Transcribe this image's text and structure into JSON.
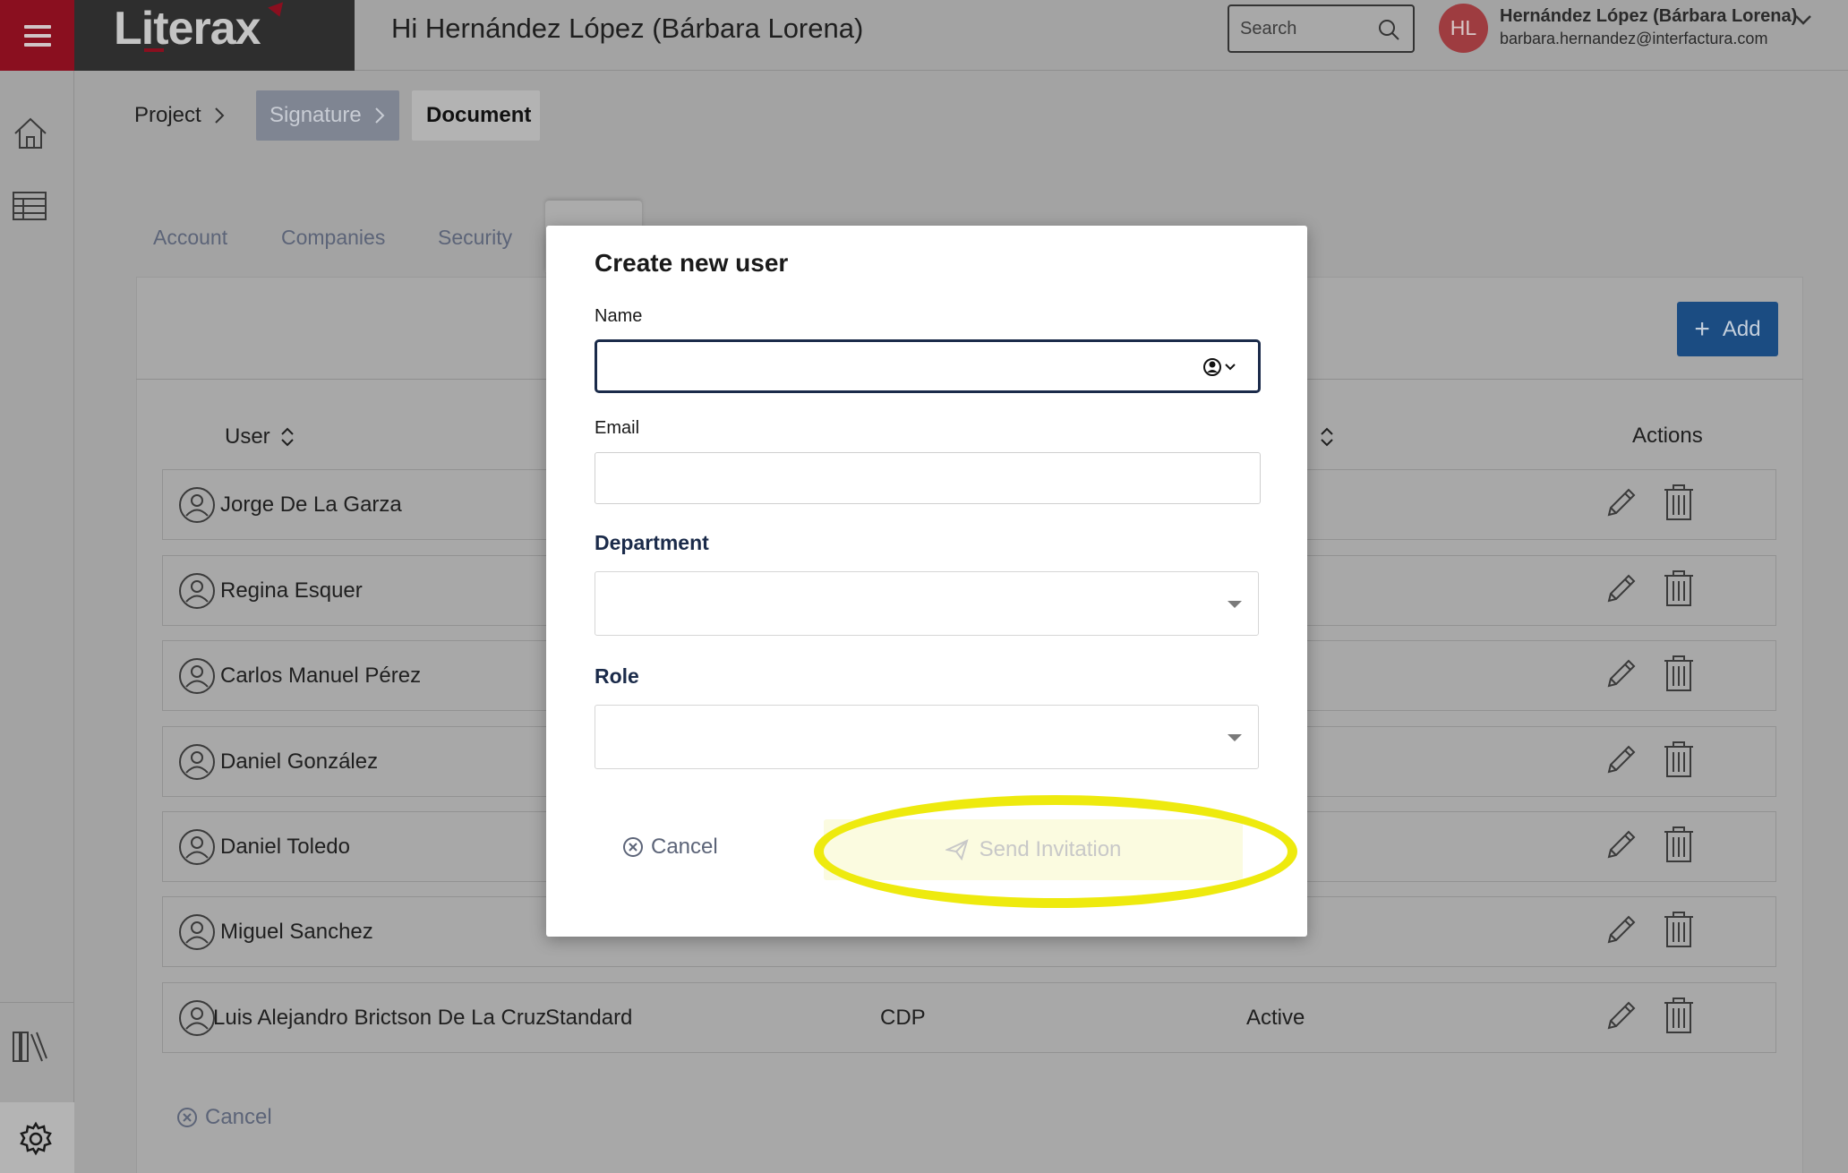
{
  "app": {
    "logo": "Literax",
    "greeting": "Hi Hernández López (Bárbara Lorena)"
  },
  "search": {
    "placeholder": "Search"
  },
  "user": {
    "initials": "HL",
    "name": "Hernández López (Bárbara Lorena)",
    "email": "barbara.hernandez@interfactura.com"
  },
  "breadcrumb": {
    "project": "Project",
    "signature": "Signature",
    "document": "Document"
  },
  "tabs": [
    "Account",
    "Companies",
    "Security"
  ],
  "table": {
    "add_label": "Add",
    "columns": {
      "user": "User",
      "actions": "Actions"
    },
    "rows": [
      {
        "name": "Jorge De La Garza",
        "role": "",
        "department": "",
        "status": ""
      },
      {
        "name": "Regina Esquer",
        "role": "",
        "department": "",
        "status": ""
      },
      {
        "name": "Carlos Manuel Pérez",
        "role": "",
        "department": "",
        "status": ""
      },
      {
        "name": "Daniel González",
        "role": "",
        "department": "",
        "status": ""
      },
      {
        "name": "Daniel Toledo",
        "role": "",
        "department": "",
        "status": ""
      },
      {
        "name": "Miguel Sanchez",
        "role": "",
        "department": "",
        "status": ""
      },
      {
        "name": "Luis Alejandro Brictson De La Cruz",
        "role": "Standard",
        "department": "CDP",
        "status": "Active"
      }
    ],
    "cancel_label": "Cancel"
  },
  "modal": {
    "title": "Create new user",
    "name_label": "Name",
    "name_value": "",
    "email_label": "Email",
    "email_value": "",
    "department_label": "Department",
    "department_value": "",
    "role_label": "Role",
    "role_value": "",
    "cancel_label": "Cancel",
    "send_label": "Send Invitation"
  },
  "colors": {
    "brand_red": "#8a0f1f",
    "navy": "#1b2b4a",
    "add_blue": "#1b4c82",
    "highlight": "#eeea0e"
  }
}
